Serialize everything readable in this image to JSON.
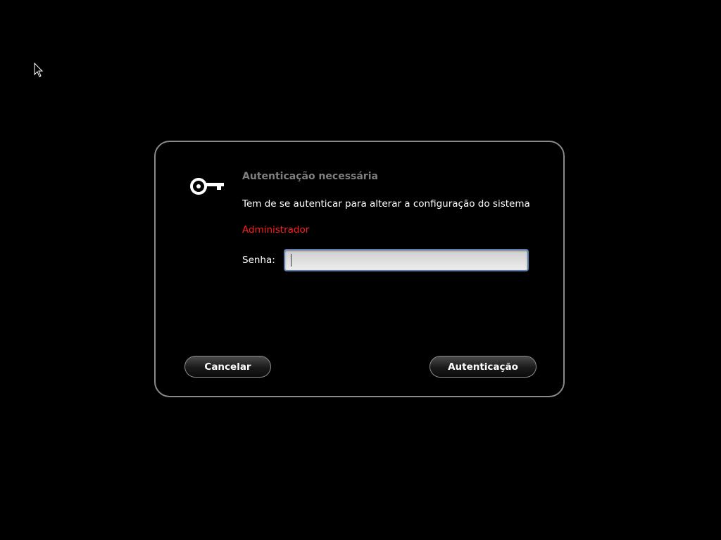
{
  "dialog": {
    "title": "Autenticação necessária",
    "message": "Tem de se autenticar para alterar a configuração do sistema",
    "user": "Administrador",
    "password_label": "Senha:",
    "password_value": "",
    "cancel_label": "Cancelar",
    "authenticate_label": "Autenticação",
    "icon": "key-icon"
  },
  "colors": {
    "background": "#000000",
    "border": "#8a8a8a",
    "title": "#7f7f7f",
    "user": "#ff1e1e",
    "input_focus": "#5d7fb0"
  }
}
